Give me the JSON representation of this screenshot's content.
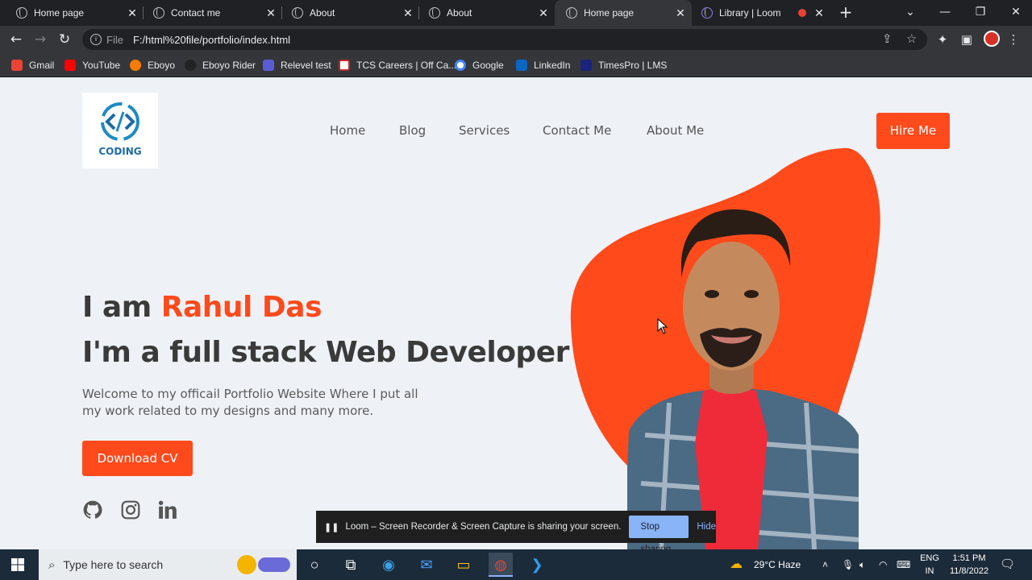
{
  "browser": {
    "tabs": [
      {
        "label": "Home page",
        "active": false
      },
      {
        "label": "Contact me",
        "active": false
      },
      {
        "label": "About",
        "active": false
      },
      {
        "label": "About",
        "active": false
      },
      {
        "label": "Home page",
        "active": true
      },
      {
        "label": "Library | Loom",
        "active": false
      }
    ],
    "address": {
      "scheme": "File",
      "url": "F:/html%20file/portfolio/index.html"
    },
    "bookmarks": [
      {
        "label": "Gmail",
        "icon": "gmail-icon",
        "color": "#ea4335"
      },
      {
        "label": "YouTube",
        "icon": "youtube-icon",
        "color": "#ff0000"
      },
      {
        "label": "Eboyo",
        "icon": "eboyo-icon",
        "color": "#f57c00"
      },
      {
        "label": "Eboyo Rider",
        "icon": "eboyo-rider-icon",
        "color": "#222222"
      },
      {
        "label": "Relevel test",
        "icon": "relevel-icon",
        "color": "#5b5bd6"
      },
      {
        "label": "TCS Careers | Off Ca...",
        "icon": "tcs-icon",
        "color": "#ffffff"
      },
      {
        "label": "Google",
        "icon": "google-icon",
        "color": "#ffffff"
      },
      {
        "label": "LinkedIn",
        "icon": "linkedin-icon",
        "color": "#0a66c2"
      },
      {
        "label": "TimesPro | LMS",
        "icon": "timespro-icon",
        "color": "#1a237e"
      }
    ]
  },
  "site": {
    "logo_text": "CODING",
    "nav": [
      "Home",
      "Blog",
      "Services",
      "Contact Me",
      "About Me"
    ],
    "hire_label": "Hire Me",
    "hero": {
      "intro": "I am ",
      "name": "Rahul Das",
      "headline": "I'm a full stack Web Developer",
      "description": "Welcome to my officail Portfolio Website Where I put all my work related to my designs and many more.",
      "cta": "Download CV"
    },
    "social": [
      "github-icon",
      "instagram-icon",
      "linkedin-icon"
    ],
    "accent": "#ff4a1c"
  },
  "loom": {
    "message": "Loom – Screen Recorder & Screen Capture is sharing your screen.",
    "stop": "Stop sharing",
    "hide": "Hide"
  },
  "taskbar": {
    "search_placeholder": "Type here to search",
    "weather": "29°C  Haze",
    "lang_top": "ENG",
    "lang_bottom": "IN",
    "time": "1:51 PM",
    "date": "11/8/2022"
  }
}
